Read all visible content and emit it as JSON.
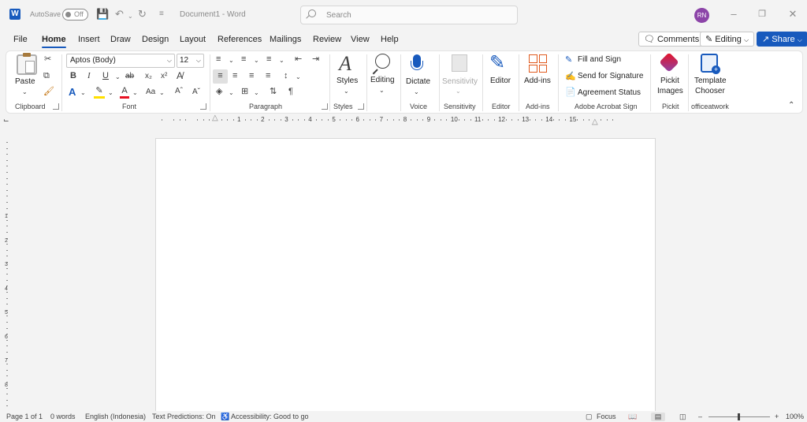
{
  "titlebar": {
    "autosave_label": "AutoSave",
    "autosave_state": "Off",
    "doc_title": "Document1  -  Word",
    "search_placeholder": "Search",
    "user_initials": "RN"
  },
  "tabs": [
    "File",
    "Home",
    "Insert",
    "Draw",
    "Design",
    "Layout",
    "References",
    "Mailings",
    "Review",
    "View",
    "Help"
  ],
  "active_tab": "Home",
  "top_buttons": {
    "comments": "Comments",
    "editing": "Editing",
    "share": "Share"
  },
  "ribbon": {
    "clipboard": {
      "paste": "Paste",
      "label": "Clipboard"
    },
    "font": {
      "name": "Aptos (Body)",
      "size": "12",
      "label": "Font"
    },
    "paragraph": {
      "label": "Paragraph"
    },
    "styles": {
      "button": "Styles",
      "label": "Styles"
    },
    "editing": {
      "button": "Editing"
    },
    "voice": {
      "button": "Dictate",
      "label": "Voice"
    },
    "sensitivity": {
      "button": "Sensitivity",
      "label": "Sensitivity"
    },
    "editor": {
      "button": "Editor",
      "label": "Editor"
    },
    "addins": {
      "button": "Add-ins",
      "label": "Add-ins"
    },
    "acrobat": {
      "fill_sign": "Fill and Sign",
      "send_signature": "Send for Signature",
      "agreement_status": "Agreement Status",
      "label": "Adobe Acrobat Sign"
    },
    "pickit": {
      "button_line1": "Pickit",
      "button_line2": "Images",
      "label": "Pickit"
    },
    "officeatwork": {
      "button_line1": "Template",
      "button_line2": "Chooser",
      "label": "officeatwork"
    }
  },
  "ruler_numbers": [
    "1",
    "2",
    "3",
    "4",
    "5",
    "6",
    "7",
    "8",
    "9",
    "10",
    "11",
    "12",
    "13",
    "14",
    "15"
  ],
  "vruler_numbers": [
    "1",
    "2",
    "3",
    "4",
    "5",
    "6",
    "7",
    "8"
  ],
  "statusbar": {
    "page": "Page 1 of 1",
    "words": "0 words",
    "language": "English (Indonesia)",
    "predictions": "Text Predictions: On",
    "accessibility": "Accessibility: Good to go",
    "focus": "Focus",
    "zoom": "100%"
  },
  "colors": {
    "accent": "#185abd",
    "avatar": "#8c44a8",
    "highlight": "#ffe000",
    "font_color": "#e81123"
  }
}
